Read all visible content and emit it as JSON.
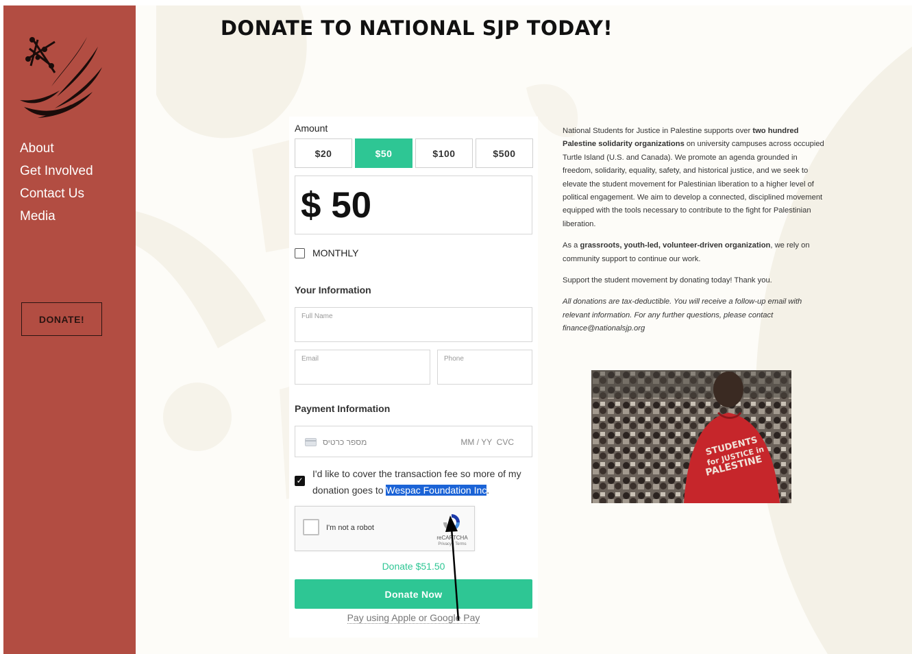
{
  "sidebar": {
    "nav": [
      "About",
      "Get Involved",
      "Contact Us",
      "Media"
    ],
    "donate_label": "DONATE!"
  },
  "page": {
    "title": "DONATE TO NATIONAL SJP TODAY!"
  },
  "form": {
    "amount_label": "Amount",
    "amounts": [
      "$20",
      "$50",
      "$100",
      "$500"
    ],
    "selected_amount": "$50",
    "amount_display": "$ 50",
    "monthly_label": "MONTHLY",
    "monthly_checked": false,
    "your_info_label": "Your Information",
    "full_name_placeholder": "Full Name",
    "email_placeholder": "Email",
    "phone_placeholder": "Phone",
    "payment_info_label": "Payment Information",
    "card_number_placeholder": "מספר כרטיס",
    "card_expiry_cvc": "MM / YY  CVC",
    "fee_text_before": "I'd like to cover the transaction fee so more of my donation goes to ",
    "fee_text_highlight": "Wespac Foundation Inc",
    "fee_text_after": ".",
    "fee_checked": true,
    "captcha_label": "I'm not a robot",
    "captcha_brand": "reCAPTCHA",
    "captcha_links": "Privacy - Terms",
    "donate_total": "Donate $51.50",
    "donate_now_label": "Donate Now",
    "alt_pay_label": "Pay using Apple or Google Pay"
  },
  "info": {
    "p1_a": "National Students for Justice in Palestine supports over ",
    "p1_b": "two hundred Palestine solidarity organizations",
    "p1_c": " on university campuses across occupied Turtle Island (U.S. and Canada). We promote an agenda grounded in freedom, solidarity, equality, safety, and historical justice, and we seek to elevate the student movement for Palestinian liberation to a higher level of political engagement. We aim to develop a connected, disciplined movement equipped with the tools necessary to contribute to the fight for Palestinian liberation.",
    "p2_a": "As a ",
    "p2_b": "grassroots, youth-led, volunteer-driven organization",
    "p2_c": ", we rely on community support to continue our work.",
    "p3": "Support the student movement by donating today! Thank you.",
    "p4": "All donations are tax-deductible. You will receive a follow-up email with relevant information. For any further questions, please contact finance@nationalsjp.org",
    "shirt_text": [
      "STUDENTS",
      "for JUSTICE in",
      "PALESTINE"
    ]
  },
  "colors": {
    "sidebar": "#b24d42",
    "accent": "#2ec694",
    "highlight": "#1b63d6"
  }
}
